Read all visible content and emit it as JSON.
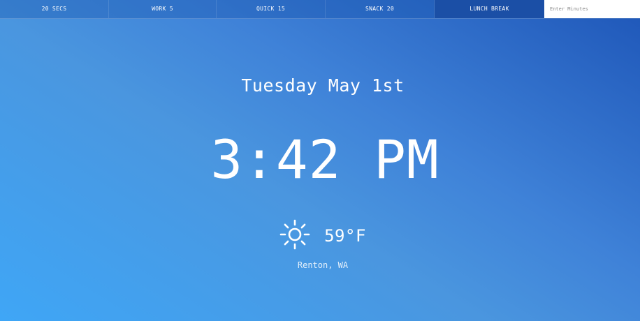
{
  "tabs": [
    {
      "label": "20 SECS"
    },
    {
      "label": "WORK 5"
    },
    {
      "label": "QUICK 15"
    },
    {
      "label": "SNACK 20"
    },
    {
      "label": "LUNCH BREAK",
      "active": true
    }
  ],
  "minutes_input": {
    "placeholder": "Enter Minutes",
    "value": ""
  },
  "date_text": "Tuesday May 1st",
  "time_text": "3:42 PM",
  "weather": {
    "icon": "sun-icon",
    "temperature": "59°F",
    "location": "Renton, WA"
  },
  "colors": {
    "gradient_start": "#3fa6f6",
    "gradient_end": "#1e56b8",
    "active_tab": "#1b4fa6"
  }
}
